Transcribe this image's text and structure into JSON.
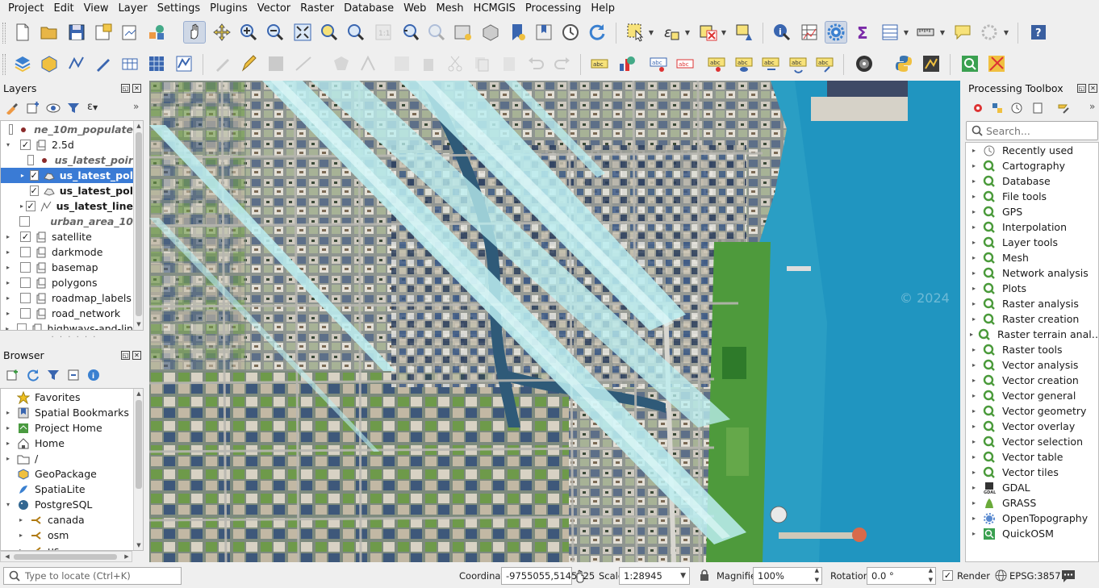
{
  "menubar": [
    "Project",
    "Edit",
    "View",
    "Layer",
    "Settings",
    "Plugins",
    "Vector",
    "Raster",
    "Database",
    "Web",
    "Mesh",
    "HCMGIS",
    "Processing",
    "Help"
  ],
  "layers_panel": {
    "title": "Layers",
    "items": [
      {
        "label": "ne_10m_populate",
        "checked": false,
        "style": "ital-bold",
        "indent": 1,
        "icon": "point-icon"
      },
      {
        "label": "2.5d",
        "checked": true,
        "style": "normal",
        "indent": 0,
        "expanded": true,
        "icon": "group-icon"
      },
      {
        "label": "us_latest_poir",
        "checked": false,
        "style": "ital-bold",
        "indent": 2,
        "icon": "point-icon"
      },
      {
        "label": "us_latest_pol",
        "checked": true,
        "style": "bold",
        "indent": 2,
        "selected": true,
        "icon": "polygon-icon"
      },
      {
        "label": "us_latest_pol",
        "checked": true,
        "style": "bold",
        "indent": 2,
        "icon": "polygon-icon"
      },
      {
        "label": "us_latest_line",
        "checked": true,
        "style": "bold",
        "indent": 2,
        "icon": "line-icon"
      },
      {
        "label": "urban_area_10",
        "checked": false,
        "style": "ital-bold",
        "indent": 1,
        "icon": "none"
      },
      {
        "label": "satellite",
        "checked": true,
        "style": "normal",
        "indent": 0,
        "icon": "group-icon"
      },
      {
        "label": "darkmode",
        "checked": false,
        "style": "normal",
        "indent": 0,
        "icon": "group-icon"
      },
      {
        "label": "basemap",
        "checked": false,
        "style": "normal",
        "indent": 0,
        "icon": "group-icon"
      },
      {
        "label": "polygons",
        "checked": false,
        "style": "normal",
        "indent": 0,
        "icon": "group-icon"
      },
      {
        "label": "roadmap_labels",
        "checked": false,
        "style": "normal",
        "indent": 0,
        "icon": "group-icon"
      },
      {
        "label": "road_network",
        "checked": false,
        "style": "normal",
        "indent": 0,
        "icon": "group-icon"
      },
      {
        "label": "highways-and-lin",
        "checked": false,
        "style": "normal",
        "indent": 0,
        "icon": "group-icon"
      }
    ]
  },
  "browser_panel": {
    "title": "Browser",
    "items": [
      {
        "label": "Favorites",
        "icon": "star-icon",
        "arrow": ""
      },
      {
        "label": "Spatial Bookmarks",
        "icon": "bookmark-icon",
        "arrow": "▸"
      },
      {
        "label": "Project Home",
        "icon": "project-home-icon",
        "arrow": "▸"
      },
      {
        "label": "Home",
        "icon": "home-icon",
        "arrow": "▸"
      },
      {
        "label": "/",
        "icon": "folder-icon",
        "arrow": "▸"
      },
      {
        "label": "GeoPackage",
        "icon": "geopackage-icon",
        "arrow": ""
      },
      {
        "label": "SpatiaLite",
        "icon": "spatialite-icon",
        "arrow": ""
      },
      {
        "label": "PostgreSQL",
        "icon": "postgresql-icon",
        "arrow": "▾"
      },
      {
        "label": "canada",
        "icon": "schema-icon",
        "arrow": "▸",
        "indent": 1
      },
      {
        "label": "osm",
        "icon": "schema-icon",
        "arrow": "▸",
        "indent": 1
      },
      {
        "label": "us",
        "icon": "schema-icon",
        "arrow": "▸",
        "indent": 1
      }
    ]
  },
  "toolbox_panel": {
    "title": "Processing Toolbox",
    "search_placeholder": "Search...",
    "items": [
      {
        "label": "Recently used",
        "icon": "clock-icon"
      },
      {
        "label": "Cartography",
        "icon": "qgis-icon"
      },
      {
        "label": "Database",
        "icon": "qgis-icon"
      },
      {
        "label": "File tools",
        "icon": "qgis-icon"
      },
      {
        "label": "GPS",
        "icon": "qgis-icon"
      },
      {
        "label": "Interpolation",
        "icon": "qgis-icon"
      },
      {
        "label": "Layer tools",
        "icon": "qgis-icon"
      },
      {
        "label": "Mesh",
        "icon": "qgis-icon"
      },
      {
        "label": "Network analysis",
        "icon": "qgis-icon"
      },
      {
        "label": "Plots",
        "icon": "qgis-icon"
      },
      {
        "label": "Raster analysis",
        "icon": "qgis-icon"
      },
      {
        "label": "Raster creation",
        "icon": "qgis-icon"
      },
      {
        "label": "Raster terrain anal…",
        "icon": "qgis-icon"
      },
      {
        "label": "Raster tools",
        "icon": "qgis-icon"
      },
      {
        "label": "Vector analysis",
        "icon": "qgis-icon"
      },
      {
        "label": "Vector creation",
        "icon": "qgis-icon"
      },
      {
        "label": "Vector general",
        "icon": "qgis-icon"
      },
      {
        "label": "Vector geometry",
        "icon": "qgis-icon"
      },
      {
        "label": "Vector overlay",
        "icon": "qgis-icon"
      },
      {
        "label": "Vector selection",
        "icon": "qgis-icon"
      },
      {
        "label": "Vector table",
        "icon": "qgis-icon"
      },
      {
        "label": "Vector tiles",
        "icon": "qgis-icon"
      },
      {
        "label": "GDAL",
        "icon": "gdal-icon"
      },
      {
        "label": "GRASS",
        "icon": "grass-icon"
      },
      {
        "label": "OpenTopography",
        "icon": "gear-icon"
      },
      {
        "label": "QuickOSM",
        "icon": "quickosm-icon"
      }
    ]
  },
  "map": {
    "watermark": "© 2024"
  },
  "statusbar": {
    "locate_placeholder": "Type to locate (Ctrl+K)",
    "coordinate_label": "Coordinate",
    "coordinate_value": "-9755055,5145125",
    "scale_label": "Scale",
    "scale_value": "1:28945",
    "magnifier_label": "Magnifier",
    "magnifier_value": "100%",
    "rotation_label": "Rotation",
    "rotation_value": "0.0 °",
    "render_label": "Render",
    "render_checked": true,
    "crs": "EPSG:3857"
  },
  "colors": {
    "selection": "#3a7bd5",
    "water": "#2a9ec4",
    "extrusion": "#bdeff2"
  }
}
